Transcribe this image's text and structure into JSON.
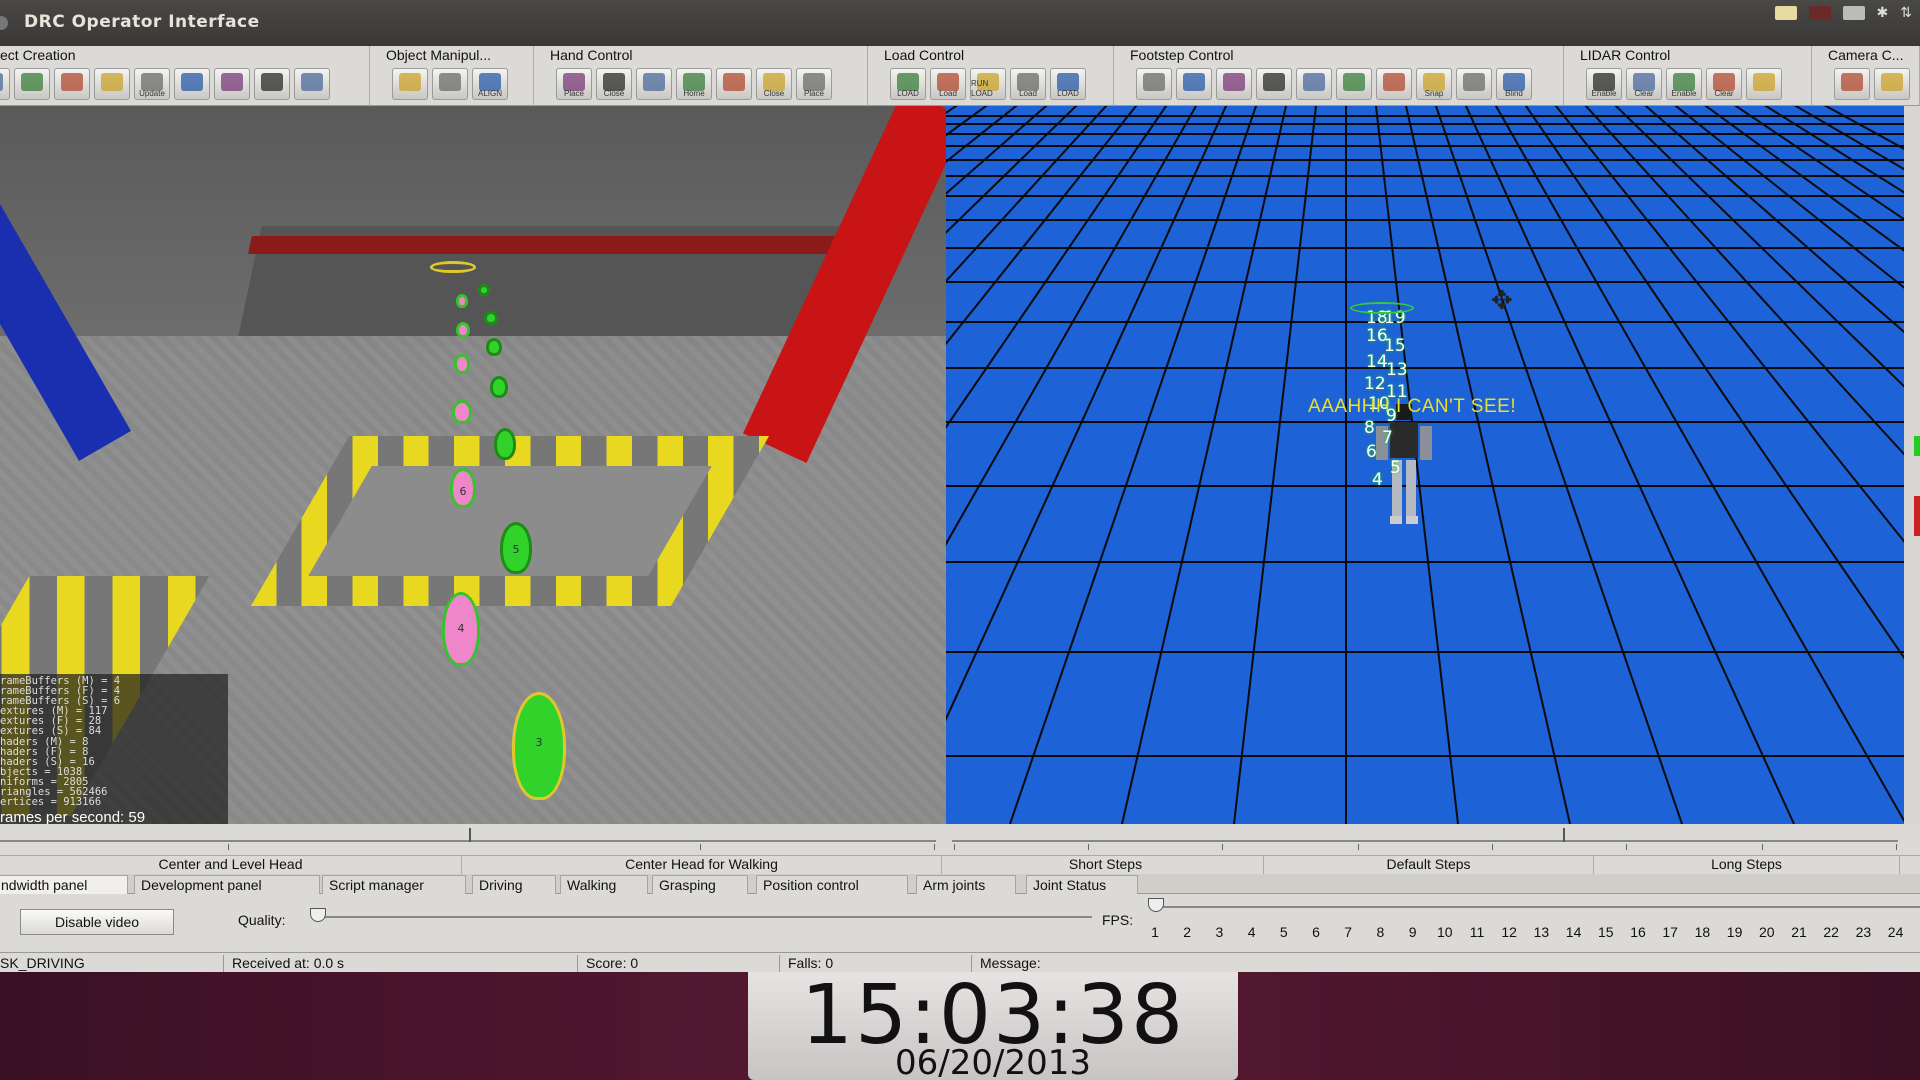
{
  "window": {
    "title": "DRC Operator Interface"
  },
  "toolbar": {
    "groups": [
      {
        "label": "ect Creation",
        "buttons": [
          "",
          "",
          "",
          "",
          "Update",
          "",
          "",
          "",
          ""
        ]
      },
      {
        "label": "Object Manipul...",
        "buttons": [
          "",
          "",
          "ALIGN"
        ]
      },
      {
        "label": "Hand Control",
        "buttons": [
          "Place",
          "Close",
          "",
          "Home",
          "",
          "Close",
          "Place"
        ]
      },
      {
        "label": "Load Control",
        "buttons": [
          "LOAD",
          "Load",
          "RUN LOAD",
          "Load",
          "LOAD"
        ]
      },
      {
        "label": "Footstep Control",
        "buttons": [
          "",
          "",
          "",
          "",
          "",
          "",
          "",
          "Snap",
          "",
          "Blind"
        ]
      },
      {
        "label": "LIDAR Control",
        "buttons": [
          "Enable",
          "Clear",
          "Enable",
          "Clear",
          ""
        ]
      },
      {
        "label": "Camera C...",
        "buttons": [
          "",
          ""
        ]
      }
    ]
  },
  "left_view": {
    "stats": [
      "rameBuffers (M) = 4",
      "rameBuffers (F) = 4",
      "rameBuffers (S) = 6",
      "extures (M) = 117",
      "extures (F) = 28",
      "extures (S) = 84",
      "haders (M) = 8",
      "haders (F) = 8",
      "haders (S) = 16",
      "bjects = 1038",
      "niforms = 2805",
      "riangles = 562466",
      "ertices = 913166"
    ],
    "fps_text": "rames per second: 59",
    "footstep_numbers": [
      "3",
      "4",
      "5",
      "6"
    ]
  },
  "right_view": {
    "message": "AAAHHH I CAN'T SEE!",
    "footstep_numbers": [
      "18",
      "19",
      "16",
      "15",
      "14",
      "13",
      "12",
      "11",
      "10",
      "9",
      "8",
      "7",
      "6",
      "5",
      "4"
    ]
  },
  "head_controls": {
    "center_and_level": "Center and Level Head",
    "center_for_walking": "Center Head for Walking",
    "short_steps": "Short Steps",
    "default_steps": "Default Steps",
    "long_steps": "Long Steps"
  },
  "tabs": [
    "ndwidth panel",
    "Development panel",
    "Script manager",
    "Driving",
    "Walking",
    "Grasping",
    "Position control",
    "Arm joints",
    "Joint Status"
  ],
  "panel": {
    "disable_video": "Disable video",
    "quality_label": "Quality:",
    "fps_label": "FPS:",
    "fps_ticks": [
      "1",
      "2",
      "3",
      "4",
      "5",
      "6",
      "7",
      "8",
      "9",
      "10",
      "11",
      "12",
      "13",
      "14",
      "15",
      "16",
      "17",
      "18",
      "19",
      "20",
      "21",
      "22",
      "23",
      "24"
    ],
    "quality_value": 0,
    "fps_value": 1
  },
  "status": {
    "task": "SK_DRIVING",
    "received": "Received at:   0.0 s",
    "score": "Score:   0",
    "falls": "Falls:   0",
    "message": "Message:"
  },
  "clock": {
    "time": "15:03:38",
    "date": "06/20/2013"
  },
  "colors": {
    "sky_blue": "#1d62d6",
    "footstep_green": "#31d22a",
    "footstep_pink": "#ef86c9",
    "hazard_yellow": "#e8d820",
    "message_yellow": "#e8e02a"
  }
}
